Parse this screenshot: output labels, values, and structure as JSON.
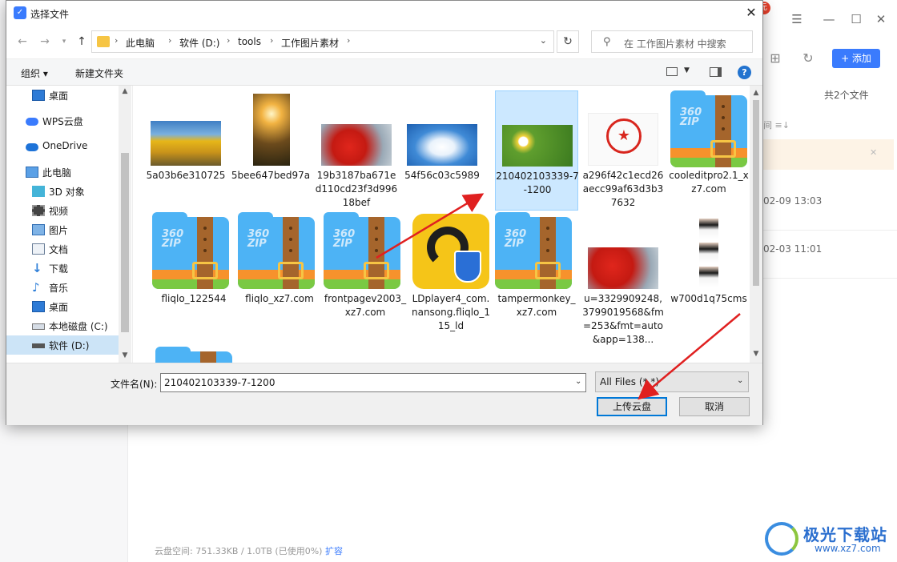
{
  "background_app": {
    "badge": "元",
    "add_button": "+ 添加",
    "file_count": "共2个文件",
    "column_label": "间 ≡↓",
    "rows": [
      "02-09 13:03",
      "02-03 11:01"
    ],
    "storage": {
      "text": "云盘空间: 751.33KB / 1.0TB (已使用0%)",
      "expand_link": "扩容"
    },
    "watermark": {
      "title": "极光下载站",
      "url": "www.xz7.com"
    }
  },
  "dialog": {
    "title": "选择文件",
    "breadcrumb": [
      "此电脑",
      "软件 (D:)",
      "tools",
      "工作图片素材"
    ],
    "search_placeholder": "在 工作图片素材 中搜索",
    "toolbar": {
      "organize": "组织 ▾",
      "new_folder": "新建文件夹"
    },
    "nav_items": [
      {
        "label": "桌面",
        "icon": "desktop-icon"
      },
      {
        "label": "WPS云盘",
        "icon": "cloud-icon"
      },
      {
        "label": "OneDrive",
        "icon": "onedrive-icon"
      },
      {
        "label": "此电脑",
        "icon": "computer-icon"
      },
      {
        "label": "3D 对象",
        "icon": "cube-icon"
      },
      {
        "label": "视频",
        "icon": "video-icon"
      },
      {
        "label": "图片",
        "icon": "picture-icon"
      },
      {
        "label": "文档",
        "icon": "document-icon"
      },
      {
        "label": "下载",
        "icon": "download-icon"
      },
      {
        "label": "音乐",
        "icon": "music-icon"
      },
      {
        "label": "桌面",
        "icon": "desktop-icon"
      },
      {
        "label": "本地磁盘 (C:)",
        "icon": "drive-icon"
      },
      {
        "label": "软件 (D:)",
        "icon": "drive-icon"
      }
    ],
    "files": [
      {
        "name": "5a03b6e310725",
        "kind": "photo-yellow-trees"
      },
      {
        "name": "5bee647bed97a",
        "kind": "photo-sunset-flowers"
      },
      {
        "name": "19b3187ba671ed110cd23f3d99618bef",
        "kind": "photo-red-leaves"
      },
      {
        "name": "54f56c03c5989",
        "kind": "photo-cloud-heart"
      },
      {
        "name": "210402103339-7-1200",
        "kind": "photo-daisy",
        "selected": true
      },
      {
        "name": "a296f42c1ecd26aecc99af63d3b37632",
        "kind": "image-red-seal"
      },
      {
        "name": "cooleditpro2.1_xz7.com",
        "kind": "zip"
      },
      {
        "name": "fliqlo_122544",
        "kind": "zip"
      },
      {
        "name": "fliqlo_xz7.com",
        "kind": "zip"
      },
      {
        "name": "frontpagev2003_xz7.com",
        "kind": "zip"
      },
      {
        "name": "LDplayer4_com.nansong.fliqlo_115_ld",
        "kind": "ldplayer-app"
      },
      {
        "name": "tampermonkey_xz7.com",
        "kind": "zip"
      },
      {
        "name": "u=3329909248,3799019568&fm=253&fmt=auto&app=138...",
        "kind": "photo-red-leaves"
      },
      {
        "name": "w700d1q75cms",
        "kind": "id-photos"
      }
    ],
    "zip_label": "360\nZIP",
    "filename_label": "文件名(N):",
    "filename_value": "210402103339-7-1200",
    "filter_value": "All Files (*.*)",
    "upload_button": "上传云盘",
    "cancel_button": "取消",
    "colors": {
      "accent": "#0078d7",
      "selection": "#cce8ff",
      "annotation_arrow": "#e02020"
    }
  }
}
